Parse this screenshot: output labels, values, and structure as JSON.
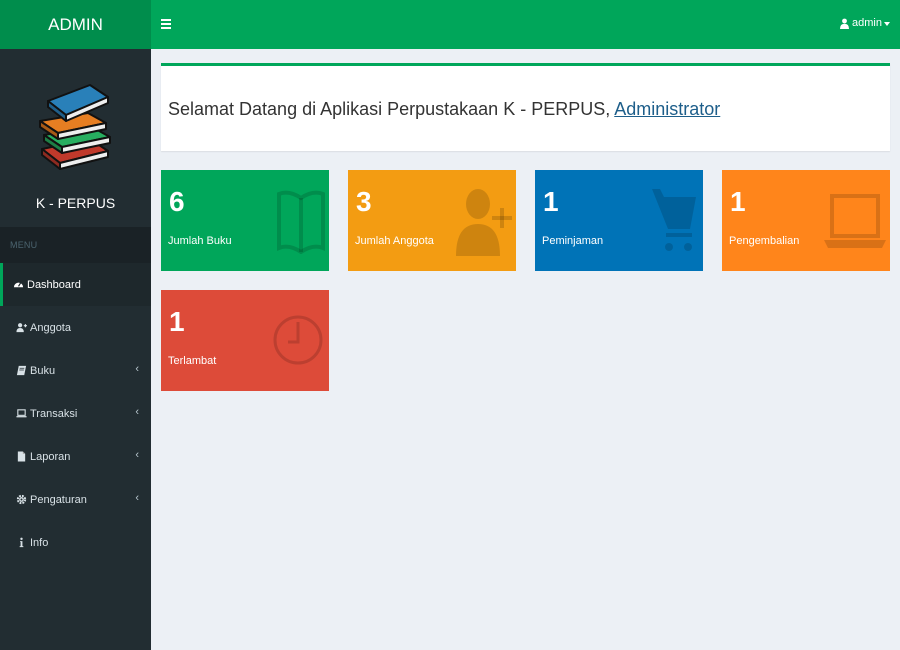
{
  "header": {
    "logo": "ADMIN",
    "user_label": "admin"
  },
  "sidebar": {
    "app_name": "K - PERPUS",
    "menu_header": "MENU",
    "items": [
      {
        "label": "Dashboard",
        "icon": "dashboard-icon"
      },
      {
        "label": "Anggota",
        "icon": "user-plus-icon"
      },
      {
        "label": "Buku",
        "icon": "book-icon"
      },
      {
        "label": "Transaksi",
        "icon": "laptop-icon"
      },
      {
        "label": "Laporan",
        "icon": "file-icon"
      },
      {
        "label": "Pengaturan",
        "icon": "gear-icon"
      },
      {
        "label": "Info",
        "icon": "info-icon"
      }
    ]
  },
  "welcome": {
    "text": "Selamat Datang di Aplikasi Perpustakaan K - PERPUS, ",
    "link": "Administrator"
  },
  "stats": [
    {
      "value": "6",
      "label": "Jumlah Buku",
      "color": "#00a65a",
      "icon": "book-open-icon"
    },
    {
      "value": "3",
      "label": "Jumlah Anggota",
      "color": "#f39c12",
      "icon": "user-plus-icon"
    },
    {
      "value": "1",
      "label": "Peminjaman",
      "color": "#0073b7",
      "icon": "cart-icon"
    },
    {
      "value": "1",
      "label": "Pengembalian",
      "color": "#ff851b",
      "icon": "laptop-icon"
    },
    {
      "value": "1",
      "label": "Terlambat",
      "color": "#dd4b39",
      "icon": "clock-icon"
    }
  ]
}
